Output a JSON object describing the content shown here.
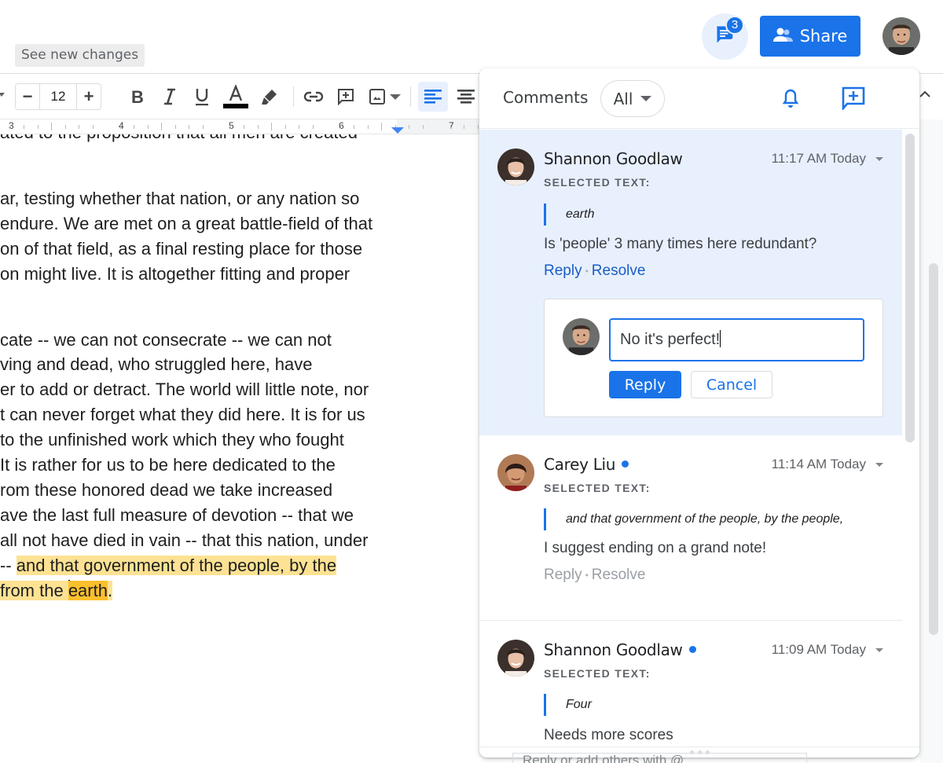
{
  "header": {
    "see_new_changes": "See new changes",
    "comments_badge_count": "3",
    "share_label": "Share"
  },
  "toolbar": {
    "font_size": "12",
    "decrease_label": "−",
    "increase_label": "+",
    "text_color": "#000000",
    "tools": [
      "bold",
      "italic",
      "underline",
      "text-color",
      "highlight",
      "link",
      "add-comment",
      "insert-image",
      "align-left",
      "align-center"
    ]
  },
  "ruler": {
    "numbers": [
      "3",
      "4",
      "5",
      "6",
      "7"
    ]
  },
  "document": {
    "lines": [
      "ated to the proposition that all men are created",
      "",
      "ar, testing whether that nation, or any nation so",
      "endure. We are met on a great battle-field of that",
      "on of that field, as a final resting place for those",
      "on might live. It is altogether fitting and proper",
      "",
      "",
      "cate -- we can not consecrate -- we can not",
      "ving and dead, who struggled here, have",
      "er to add or detract. The world will little note, nor",
      "t can never forget what they did here. It is for us",
      "to the unfinished work which they who fought",
      " It is rather for us to be here dedicated to the",
      "rom these honored dead we take increased",
      "ave the last full measure of devotion -- that we",
      "all not have died in vain -- that this nation, under"
    ],
    "line_17_prefix": " -- ",
    "line_17_highlight": "and that government of the people, by the ",
    "line_18_highlight_prefix": "from the ",
    "line_18_strong": "earth",
    "line_18_suffix": "."
  },
  "comments_panel": {
    "title": "Comments",
    "filter_value": "All",
    "threads": [
      {
        "author": "Shannon Goodlaw",
        "unread": false,
        "time": "11:17 AM Today",
        "selected_label": "SELECTED TEXT:",
        "quote": "earth",
        "text": "Is 'people' 3 many times here redundant?",
        "reply": "Reply",
        "resolve": "Resolve",
        "active": true
      },
      {
        "author": "Carey Liu",
        "unread": true,
        "time": "11:14 AM Today",
        "selected_label": "SELECTED TEXT:",
        "quote": "and that government of the people, by the people,",
        "text": "I suggest ending on a grand note!",
        "reply": "Reply",
        "resolve": "Resolve",
        "active": false
      },
      {
        "author": "Shannon Goodlaw",
        "unread": true,
        "time": "11:09 AM Today",
        "selected_label": "SELECTED TEXT:",
        "quote": "Four",
        "text": "Needs more scores",
        "active": false
      }
    ],
    "reply_box": {
      "value": "No it's perfect!",
      "reply_button": "Reply",
      "cancel_button": "Cancel"
    },
    "underlying_reply_placeholder": "Reply or add others with @"
  },
  "colors": {
    "accent": "#1a73e8",
    "highlight": "#fde293",
    "highlight_strong": "#fbc02d",
    "active_thread_bg": "#e8f0fe"
  }
}
